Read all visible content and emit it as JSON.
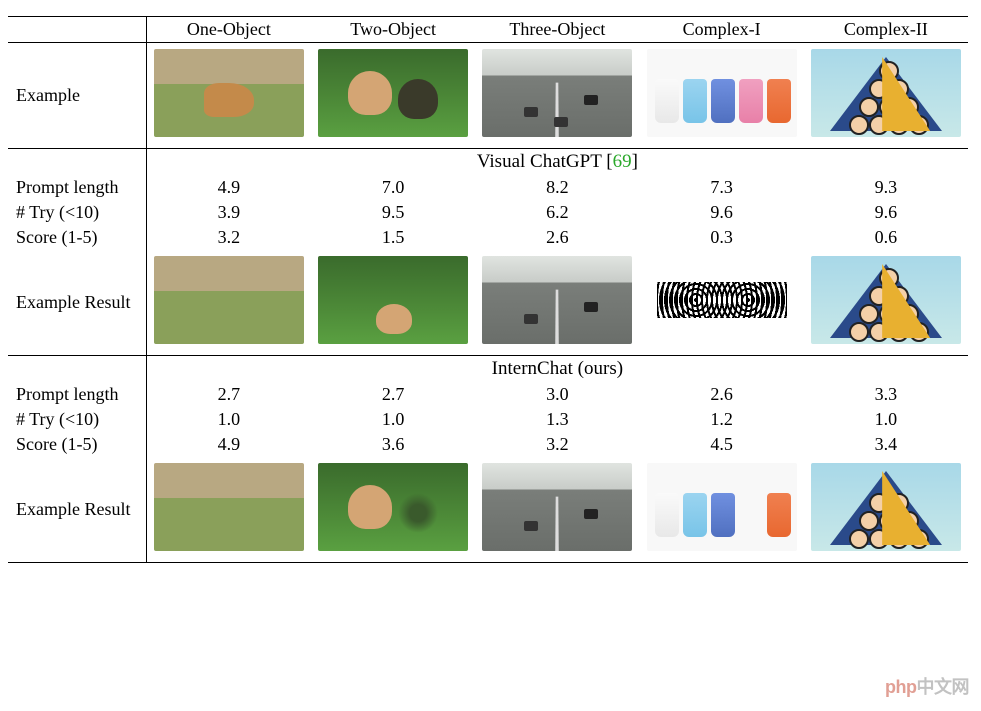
{
  "columns": {
    "c1": "One-Object",
    "c2": "Two-Object",
    "c3": "Three-Object",
    "c4": "Complex-I",
    "c5": "Complex-II"
  },
  "row_labels": {
    "example": "Example",
    "prompt_length": "Prompt length",
    "try": "# Try (<10)",
    "score": "Score (1-5)",
    "example_result": "Example Result"
  },
  "sections": {
    "visual_chatgpt": {
      "title": "Visual ChatGPT",
      "cite_open": "[",
      "cite_num": "69",
      "cite_close": "]",
      "prompt_length": {
        "c1": "4.9",
        "c2": "7.0",
        "c3": "8.2",
        "c4": "7.3",
        "c5": "9.3"
      },
      "try": {
        "c1": "3.9",
        "c2": "9.5",
        "c3": "6.2",
        "c4": "9.6",
        "c5": "9.6"
      },
      "score": {
        "c1": "3.2",
        "c2": "1.5",
        "c3": "2.6",
        "c4": "0.3",
        "c5": "0.6"
      }
    },
    "internchat": {
      "title": "InternChat (ours)",
      "prompt_length": {
        "c1": "2.7",
        "c2": "2.7",
        "c3": "3.0",
        "c4": "2.6",
        "c5": "3.3"
      },
      "try": {
        "c1": "1.0",
        "c2": "1.0",
        "c3": "1.3",
        "c4": "1.2",
        "c5": "1.0"
      },
      "score": {
        "c1": "4.9",
        "c2": "3.6",
        "c3": "3.2",
        "c4": "4.5",
        "c5": "3.4"
      }
    }
  },
  "watermark": {
    "left": "php",
    "right": "中文网"
  },
  "chart_data": {
    "type": "table",
    "columns": [
      "One-Object",
      "Two-Object",
      "Three-Object",
      "Complex-I",
      "Complex-II"
    ],
    "metrics": [
      "Prompt length",
      "# Try (<10)",
      "Score (1-5)"
    ],
    "methods": [
      {
        "name": "Visual ChatGPT [69]",
        "Prompt length": [
          4.9,
          7.0,
          8.2,
          7.3,
          9.3
        ],
        "# Try (<10)": [
          3.9,
          9.5,
          6.2,
          9.6,
          9.6
        ],
        "Score (1-5)": [
          3.2,
          1.5,
          2.6,
          0.3,
          0.6
        ]
      },
      {
        "name": "InternChat (ours)",
        "Prompt length": [
          2.7,
          2.7,
          3.0,
          2.6,
          3.3
        ],
        "# Try (<10)": [
          1.0,
          1.0,
          1.3,
          1.2,
          1.0
        ],
        "Score (1-5)": [
          4.9,
          3.6,
          3.2,
          4.5,
          3.4
        ]
      }
    ]
  }
}
